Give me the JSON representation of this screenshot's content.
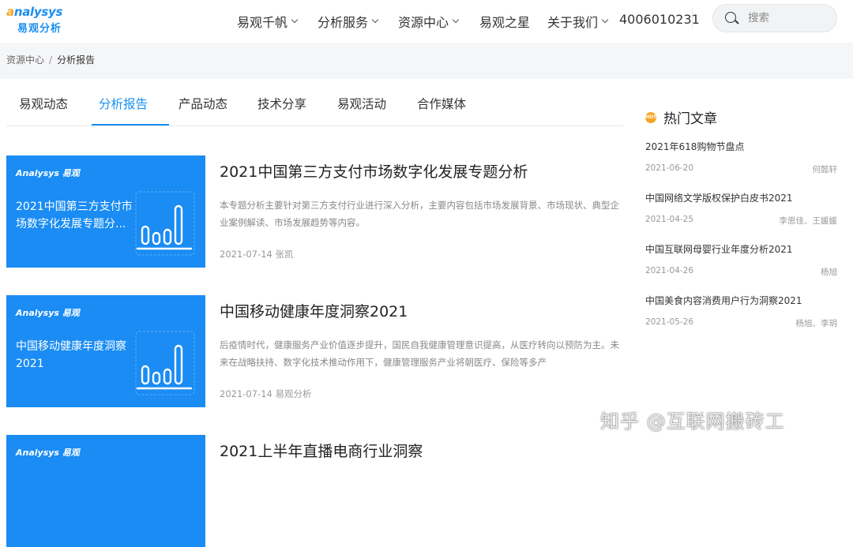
{
  "header": {
    "logo_text_a": "a",
    "logo_text_b": "nalysys",
    "logo_cn": "易观分析",
    "nav": [
      {
        "label": "易观千帆",
        "has_menu": true
      },
      {
        "label": "分析服务",
        "has_menu": true
      },
      {
        "label": "资源中心",
        "has_menu": true
      },
      {
        "label": "易观之星",
        "has_menu": false
      },
      {
        "label": "关于我们",
        "has_menu": true
      }
    ],
    "phone": "4006010231",
    "search_placeholder": "搜索"
  },
  "breadcrumb": {
    "parent": "资源中心",
    "separator": "/",
    "current": "分析报告"
  },
  "tabs": [
    {
      "label": "易观动态",
      "active": false
    },
    {
      "label": "分析报告",
      "active": true
    },
    {
      "label": "产品动态",
      "active": false
    },
    {
      "label": "技术分享",
      "active": false
    },
    {
      "label": "易观活动",
      "active": false
    },
    {
      "label": "合作媒体",
      "active": false
    }
  ],
  "articles": [
    {
      "thumb_brand": "Analysys 易观",
      "thumb_title": "2021中国第三方支付市场数字化发展专题分...",
      "title": "2021中国第三方支付市场数字化发展专题分析",
      "desc": "本专题分析主要针对第三方支付行业进行深入分析，主要内容包括市场发展背景、市场现状、典型企业案例解读、市场发展趋势等内容。",
      "date": "2021-07-14",
      "author": "张凯"
    },
    {
      "thumb_brand": "Analysys 易观",
      "thumb_title": "中国移动健康年度洞察2021",
      "title": "中国移动健康年度洞察2021",
      "desc": "后疫情时代，健康服务产业价值逐步提升，国民自我健康管理意识提高，从医疗转向以预防为主。未来在战略扶持、数字化技术推动作用下，健康管理服务产业将朝医疗、保险等多产",
      "date": "2021-07-14",
      "author": "易观分析"
    },
    {
      "thumb_brand": "Analysys 易观",
      "thumb_title": "",
      "title": "2021上半年直播电商行业洞察",
      "desc": "",
      "date": "",
      "author": ""
    }
  ],
  "sidebar": {
    "title": "热门文章",
    "hot_icon_text": "HOT",
    "items": [
      {
        "title": "2021年618购物节盘点",
        "date": "2021-06-20",
        "author": "何懿轩"
      },
      {
        "title": "中国网络文学版权保护白皮书2021",
        "date": "2021-04-25",
        "author": "李思佳、王媛媛"
      },
      {
        "title": "中国互联网母婴行业年度分析2021",
        "date": "2021-04-26",
        "author": "杨旭"
      },
      {
        "title": "中国美食内容消费用户行为洞察2021",
        "date": "2021-05-26",
        "author": "杨旭、李玥"
      }
    ]
  },
  "watermark": "知乎 @互联网搬砖工",
  "colors": {
    "accent": "#1a8ff0",
    "thumb_bg": "#1a8cf3",
    "logo_orange": "#f5a623"
  }
}
